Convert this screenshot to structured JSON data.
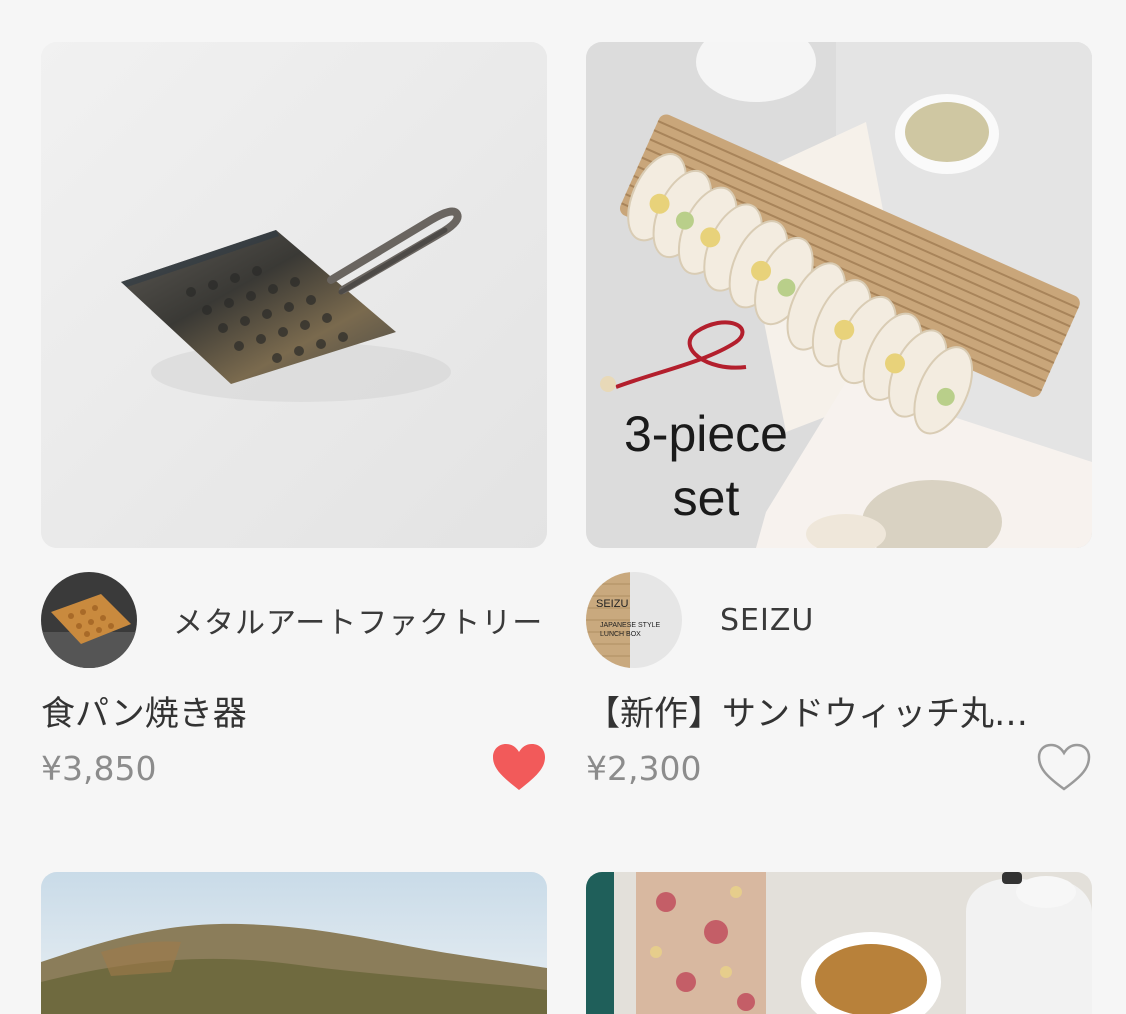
{
  "products": [
    {
      "shop_name": "メタルアートファクトリー",
      "title": "食パン焼き器",
      "price": "¥3,850",
      "favorited": true,
      "image_icon": "toast-grill-pan-photo",
      "avatar_icon": "waffle-toast-avatar"
    },
    {
      "shop_name": "SEIZU",
      "title": "【新作】サンドウィッチ丸…",
      "price": "¥2,300",
      "favorited": false,
      "image_icon": "sandwich-lunchbox-photo",
      "image_overlay_text": "3-piece\nset",
      "avatar_icon": "seizu-lunchbox-avatar",
      "avatar_text": {
        "brand": "SEIZU",
        "line1": "JAPANESE STYLE",
        "line2": "LUNCH BOX"
      }
    },
    {
      "image_icon": "mountain-landscape-photo"
    },
    {
      "image_icon": "tea-canister-teapot-photo"
    }
  ],
  "colors": {
    "background": "#f6f6f6",
    "heart_filled": "#f25a5a",
    "heart_outline": "#9a9a9a",
    "price": "#8c8c8c",
    "text": "#333333"
  }
}
